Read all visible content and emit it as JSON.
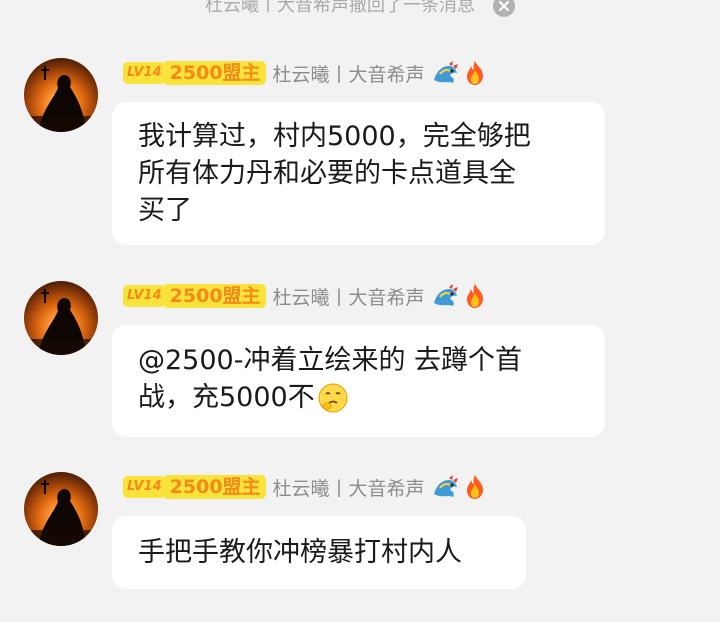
{
  "recall_notice": {
    "text": "杜云曦丨大音希声撤回了一条消息",
    "close_icon": "close-icon"
  },
  "messages": [
    {
      "level": "LV14",
      "title": "2500盟主",
      "sender": "杜云曦丨大音希声",
      "icons": [
        "dragon-icon",
        "fire-icon"
      ],
      "lines": [
        "我计算过，村内5000，完全够把",
        "所有体力丹和必要的卡点道具全",
        "买了"
      ]
    },
    {
      "level": "LV14",
      "title": "2500盟主",
      "sender": "杜云曦丨大音希声",
      "icons": [
        "dragon-icon",
        "fire-icon"
      ],
      "lines": [
        "@2500-冲着立绘来的 去蹲个首",
        "战，充5000不"
      ],
      "emoji": "thinking-face-emoji"
    },
    {
      "level": "LV14",
      "title": "2500盟主",
      "sender": "杜云曦丨大音希声",
      "icons": [
        "dragon-icon",
        "fire-icon"
      ],
      "lines": [
        "手把手教你冲榜暴打村内人"
      ]
    }
  ]
}
